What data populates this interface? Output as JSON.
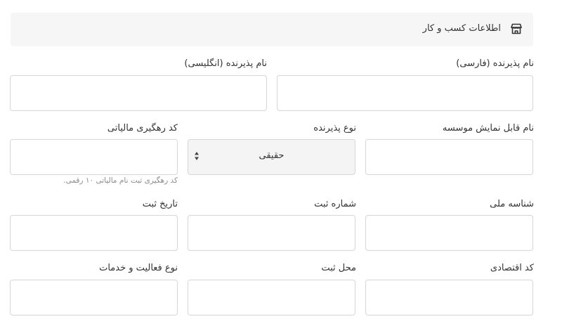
{
  "section": {
    "title": "اطلاعات کسب و کار",
    "icon": "store-icon"
  },
  "fields": {
    "merchant_name_fa": {
      "label": "نام پذیرنده (فارسی)",
      "value": ""
    },
    "merchant_name_en": {
      "label": "نام پذیرنده (انگلیسی)",
      "value": ""
    },
    "display_name": {
      "label": "نام قابل نمایش موسسه",
      "value": ""
    },
    "merchant_type": {
      "label": "نوع پذیرنده",
      "value": "حقیقی"
    },
    "tax_tracking_code": {
      "label": "کد رهگیری مالیاتی",
      "value": "",
      "help": "کد رهگیری ثبت نام مالیاتی ۱۰ رقمی."
    },
    "national_id": {
      "label": "شناسه ملی",
      "value": ""
    },
    "registration_number": {
      "label": "شماره ثبت",
      "value": ""
    },
    "registration_date": {
      "label": "تاریخ ثبت",
      "value": ""
    },
    "economic_code": {
      "label": "کد اقتصادی",
      "value": ""
    },
    "registration_place": {
      "label": "محل ثبت",
      "value": ""
    },
    "activity_type": {
      "label": "نوع فعالیت و خدمات",
      "value": ""
    }
  },
  "colors": {
    "header_bg": "#f6f6f6",
    "border": "#d6d6d6",
    "select_bg": "#f4f4f4",
    "help_text": "#8c8c8c"
  }
}
